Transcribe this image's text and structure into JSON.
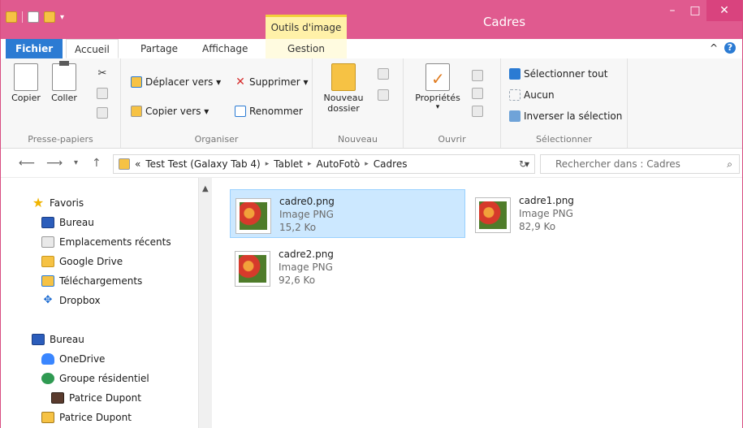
{
  "window": {
    "title": "Cadres",
    "tools_tab": "Outils d'image"
  },
  "ribbon_tabs": {
    "file": "Fichier",
    "home": "Accueil",
    "share": "Partage",
    "view": "Affichage",
    "manage": "Gestion"
  },
  "ribbon": {
    "clipboard": {
      "copy": "Copier",
      "paste": "Coller",
      "label": "Presse-papiers"
    },
    "organize": {
      "move_to": "Déplacer vers ▾",
      "copy_to": "Copier vers ▾",
      "delete": "Supprimer ▾",
      "rename": "Renommer",
      "label": "Organiser"
    },
    "new": {
      "new_folder_line1": "Nouveau",
      "new_folder_line2": "dossier",
      "label": "Nouveau"
    },
    "open": {
      "properties": "Propriétés",
      "label": "Ouvrir"
    },
    "select": {
      "select_all": "Sélectionner tout",
      "none": "Aucun",
      "invert": "Inverser la sélection",
      "label": "Sélectionner"
    }
  },
  "address": {
    "prefix": "«",
    "crumbs": [
      "Test Test (Galaxy Tab 4)",
      "Tablet",
      "AutoFotò",
      "Cadres"
    ],
    "search_placeholder": "Rechercher dans : Cadres"
  },
  "sidebar": {
    "favorites": "Favoris",
    "items": [
      "Bureau",
      "Emplacements récents",
      "Google Drive",
      "Téléchargements",
      "Dropbox"
    ],
    "desktop": "Bureau",
    "tree": [
      "OneDrive",
      "Groupe résidentiel",
      "Patrice Dupont",
      "Patrice Dupont"
    ]
  },
  "files": [
    {
      "name": "cadre0.png",
      "type": "Image PNG",
      "size": "15,2 Ko"
    },
    {
      "name": "cadre1.png",
      "type": "Image PNG",
      "size": "82,9 Ko"
    },
    {
      "name": "cadre2.png",
      "type": "Image PNG",
      "size": "92,6 Ko"
    }
  ],
  "colors": {
    "titlebar": "#e05a8f",
    "file_tab": "#2b7bd3",
    "selection": "#cce8ff"
  }
}
